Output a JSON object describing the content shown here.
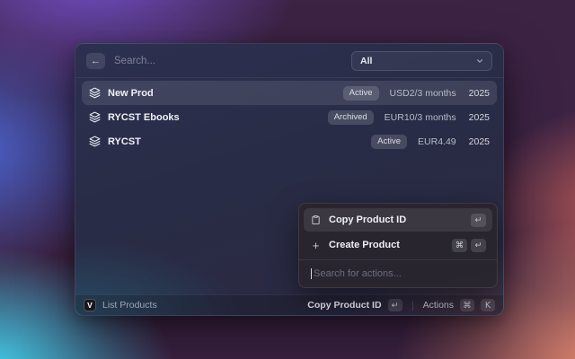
{
  "window": {
    "header": {
      "back_icon": "←",
      "search_placeholder": "Search...",
      "filter": {
        "value": "All"
      }
    },
    "products": [
      {
        "name": "New Prod",
        "status": "Active",
        "price": "USD2/3 months",
        "year": "2025"
      },
      {
        "name": "RYCST Ebooks",
        "status": "Archived",
        "price": "EUR10/3 months",
        "year": "2025"
      },
      {
        "name": "RYCST",
        "status": "Active",
        "price": "EUR4.49",
        "year": "2025"
      }
    ],
    "actions_panel": {
      "items": [
        {
          "label": "Copy Product ID",
          "icon": "clipboard-icon",
          "keys": [
            "↵"
          ]
        },
        {
          "label": "Create Product",
          "icon": "plus-icon",
          "keys": [
            "⌘",
            "↵"
          ]
        }
      ],
      "search_placeholder": "Search for actions..."
    },
    "footer": {
      "logo_glyph": "V",
      "app_label": "List Products",
      "primary_action": "Copy Product ID",
      "primary_key": "↵",
      "secondary_action": "Actions",
      "secondary_keys": [
        "⌘",
        "K"
      ]
    }
  },
  "colors": {
    "bg_purple": "#6f4cc0",
    "bg_blue": "#4a63cf",
    "bg_cyan": "#41d0ea",
    "bg_salmon": "#ef8f70",
    "bg_plum": "#3c2344",
    "window_bg": "#2a2c46",
    "panel_bg": "#29252f",
    "badge_bg": "rgba(255,255,255,0.15)"
  }
}
